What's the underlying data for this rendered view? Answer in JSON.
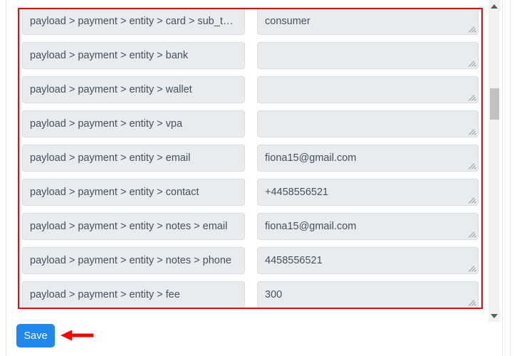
{
  "panel": {
    "name": "field-mapping-panel",
    "rows": [
      {
        "path": "payload > payment > entity > card > sub_type",
        "value": "consumer"
      },
      {
        "path": "payload > payment > entity > bank",
        "value": ""
      },
      {
        "path": "payload > payment > entity > wallet",
        "value": ""
      },
      {
        "path": "payload > payment > entity > vpa",
        "value": ""
      },
      {
        "path": "payload > payment > entity > email",
        "value": "fiona15@gmail.com"
      },
      {
        "path": "payload > payment > entity > contact",
        "value": "+4458556521"
      },
      {
        "path": "payload > payment > entity > notes > email",
        "value": "fiona15@gmail.com"
      },
      {
        "path": "payload > payment > entity > notes > phone",
        "value": "4458556521"
      },
      {
        "path": "payload > payment > entity > fee",
        "value": "300"
      }
    ]
  },
  "scrollbar": {
    "up_arrow_icon": "triangle-up-icon",
    "down_arrow_icon": "triangle-down-icon",
    "thumb_icon": "scrollbar-thumb"
  },
  "footer": {
    "save_label": "Save"
  },
  "annotations": {
    "highlight_rect_color": "#ff0000",
    "arrow_color": "#ff0000",
    "arrow_icon": "arrow-left-icon"
  },
  "colors": {
    "accent": "#1e87f0",
    "field_background": "#e8ecef",
    "field_border": "#d7dde3",
    "text": "#445160",
    "annotation": "#ff0000"
  }
}
